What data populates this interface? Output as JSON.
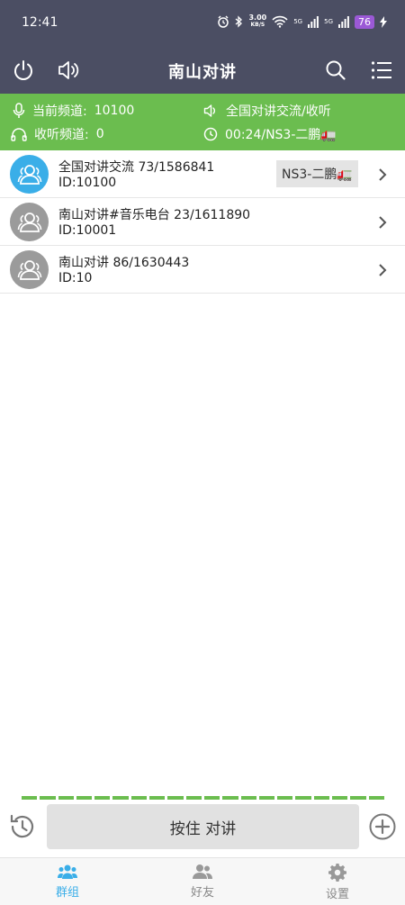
{
  "status_bar": {
    "time": "12:41",
    "net_speed_value": "3.00",
    "net_speed_unit": "KB/S",
    "signal_1": "5G",
    "signal_2": "5G",
    "battery": "76"
  },
  "app_bar": {
    "title": "南山对讲",
    "icons": [
      "power-icon",
      "speaker-icon",
      "search-icon",
      "menu-list-icon"
    ]
  },
  "info_panel": {
    "current_channel_label": "当前频道:",
    "current_channel_value": "10100",
    "listen_channel_label": "收听频道:",
    "listen_channel_value": "0",
    "speaker_text": "全国对讲交流/收听",
    "last_speech": "00:24/NS3-二鹏🚛"
  },
  "groups": [
    {
      "name": "全国对讲交流 73/1586841",
      "id": "ID:10100",
      "speaker": "NS3-二鹏🚛",
      "active": true
    },
    {
      "name": "南山对讲#音乐电台 23/1611890",
      "id": "ID:10001",
      "speaker": "",
      "active": false
    },
    {
      "name": "南山对讲 86/1630443",
      "id": "ID:10",
      "speaker": "",
      "active": false
    }
  ],
  "ptt": {
    "button_label": "按住 对讲"
  },
  "bottom_nav": {
    "groups_label": "群组",
    "friends_label": "好友",
    "settings_label": "设置"
  },
  "colors": {
    "header": "#4b4e63",
    "panel_green": "#6bbd4f",
    "active_blue": "#3aaee8",
    "inactive_gray": "#9b9b9b"
  }
}
